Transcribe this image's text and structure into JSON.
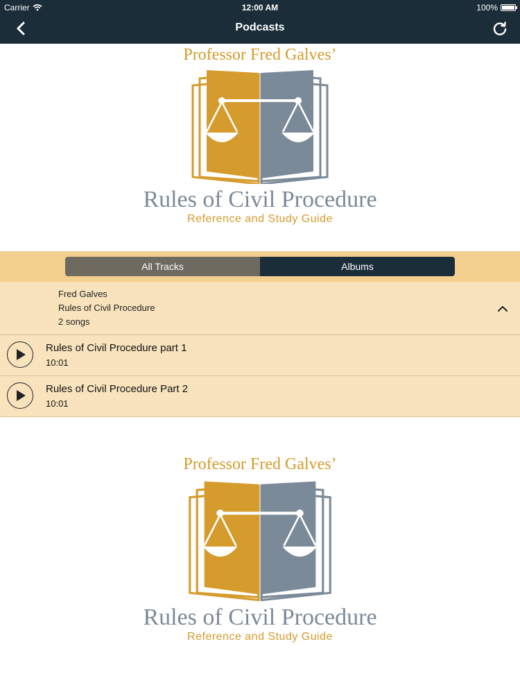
{
  "status": {
    "carrier": "Carrier",
    "time": "12:00 AM",
    "battery": "100%"
  },
  "nav": {
    "title": "Podcasts"
  },
  "logo": {
    "prof": "Professor Fred Galves’",
    "main": "Rules of Civil Procedure",
    "sub": "Reference and Study Guide"
  },
  "segments": {
    "tracks": "All Tracks",
    "albums": "Albums"
  },
  "album": {
    "artist": "Fred Galves",
    "name": "Rules of Civil Procedure",
    "count": "2 songs"
  },
  "tracks": [
    {
      "title": "Rules of Civil Procedure part 1",
      "duration": "10:01"
    },
    {
      "title": "Rules of Civil Procedure Part 2",
      "duration": "10:01"
    }
  ],
  "colors": {
    "navy": "#1c2d3a",
    "gold": "#d59b2c",
    "slate": "#7b8a98",
    "cream": "#f8e3bd",
    "segbar": "#f3cf8e"
  }
}
